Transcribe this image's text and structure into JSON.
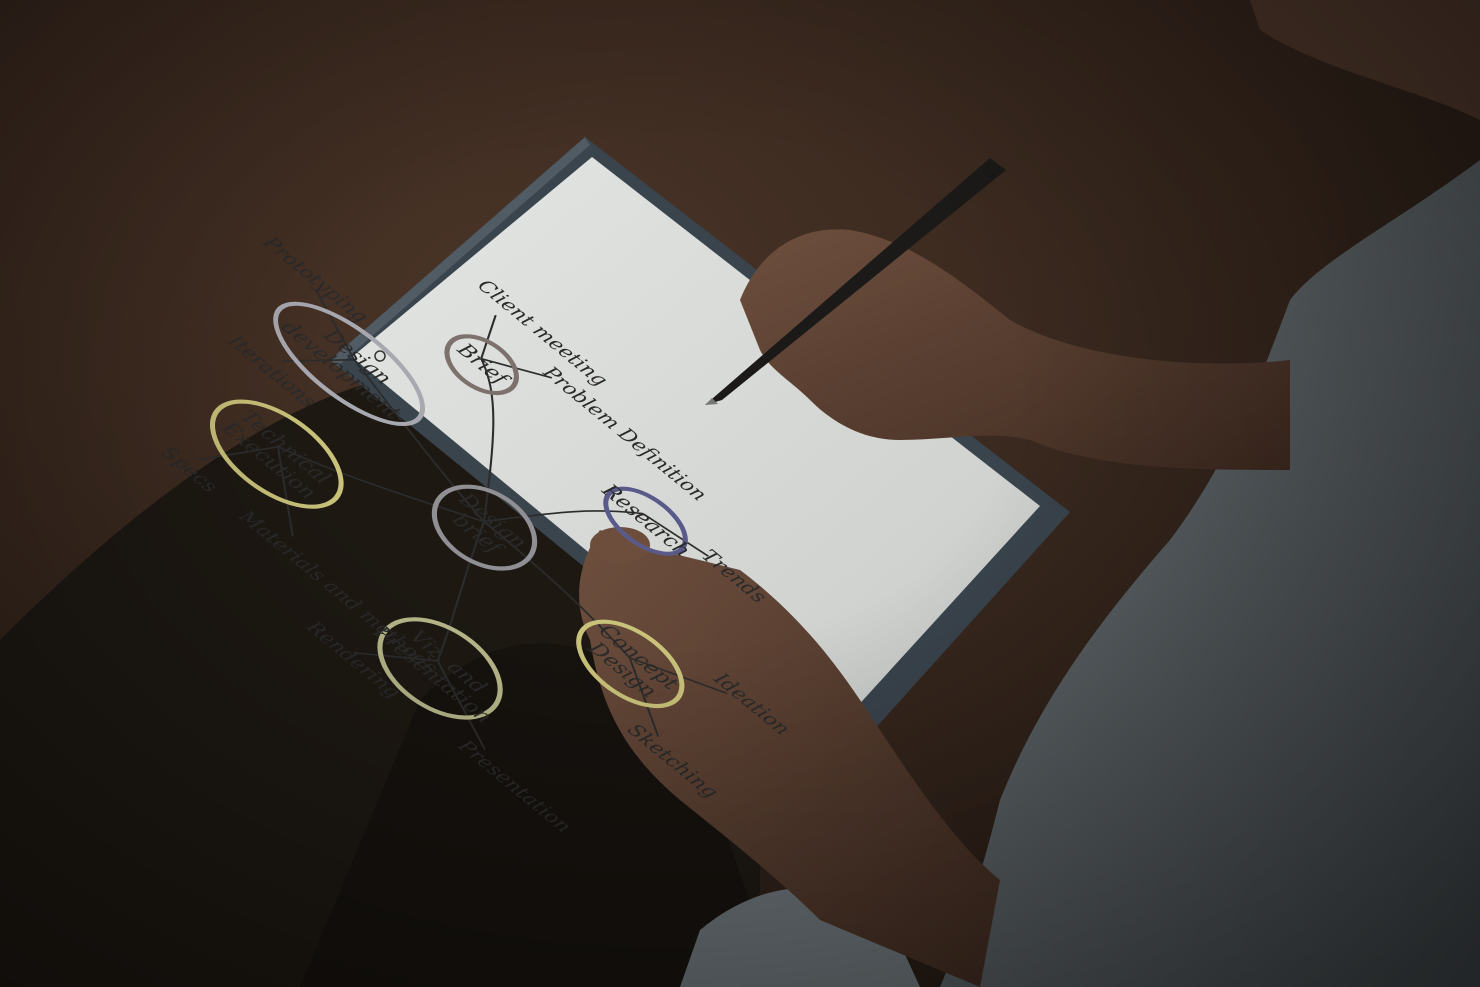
{
  "scene": {
    "description_colors": {
      "background": "#3b2a20",
      "pants": "#1c1712",
      "shirt": "#5b6266",
      "skin": "#5a4032",
      "tablet_frame": "#3c4650",
      "screen": "#d9dcd9",
      "stylus": "#1b1a18"
    }
  },
  "mindmap": {
    "center": "Design brief",
    "nodes": [
      {
        "label": "Brief",
        "color": "#7d716e"
      },
      {
        "label": "Research",
        "color": "#5a5a8a"
      },
      {
        "label": "Design development",
        "color": "#a8a8b0"
      },
      {
        "label": "Technical Execution",
        "color": "#c9c27a"
      },
      {
        "label": "Concept Design",
        "color": "#c9c27a"
      },
      {
        "label": "Viz. and Presentation",
        "color": "#b8b88a"
      }
    ],
    "leaves": {
      "brief_1": "Client meeting",
      "brief_2": "Problem Definition",
      "research_1": "Trends",
      "dev_1": "Prototyping",
      "dev_2": "Iterations",
      "tech_1": "Specs",
      "tech_2": "Materials and methods",
      "concept_1": "Ideation",
      "concept_2": "Sketching",
      "viz_1": "Rendering",
      "viz_2": "Presentation"
    }
  }
}
